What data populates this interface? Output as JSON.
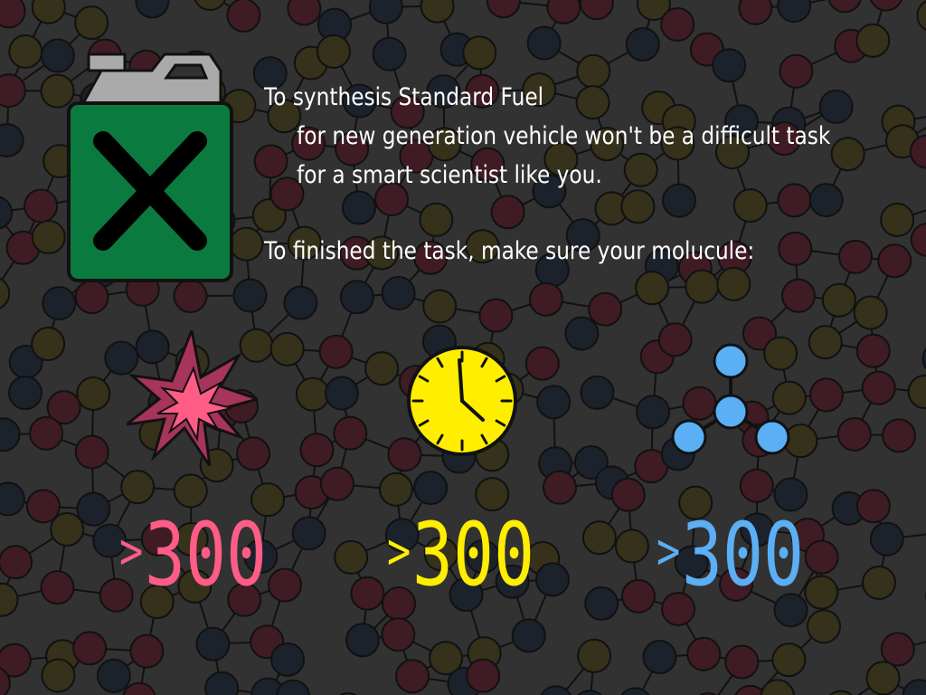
{
  "description": {
    "line1": "To synthesis Standard Fuel",
    "line2": "for new generation vehicle won't be a difficult task",
    "line3": "for a smart scientist like you.",
    "line4": "To finished the task, make sure your molucule:"
  },
  "requirements": [
    {
      "icon": "explosion-icon",
      "symbol": ">",
      "value": "300",
      "color": "#ff5c86"
    },
    {
      "icon": "clock-icon",
      "symbol": ">",
      "value": "300",
      "color": "#ffee00"
    },
    {
      "icon": "molecule-icon",
      "symbol": ">",
      "value": "300",
      "color": "#5aaff5"
    }
  ],
  "fuel_can": {
    "icon": "fuel-can-icon",
    "body_color": "#0b7a3e",
    "cap_color": "#aaaaaa"
  },
  "background": {
    "base_color": "#323232",
    "node_colors": [
      "#3f1b24",
      "#35311a",
      "#1b222c"
    ]
  }
}
